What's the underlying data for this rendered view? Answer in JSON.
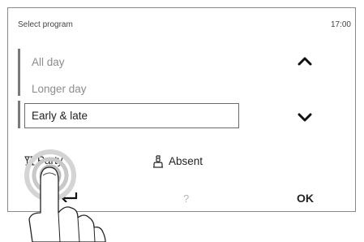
{
  "header": {
    "title": "Select program",
    "time": "17:00"
  },
  "programs": {
    "items": [
      "All day",
      "Longer day"
    ],
    "selected": "Early & late"
  },
  "nav": {
    "up_icon": "chevron-up-icon",
    "down_icon": "chevron-down-icon"
  },
  "actions": {
    "party_label": "Party",
    "absent_label": "Absent",
    "help_label": "?",
    "ok_label": "OK",
    "back_icon": "back-arrow-icon"
  },
  "colors": {
    "text_dark": "#222222",
    "text_muted": "#8c8c8c",
    "border": "#8a8a8a"
  }
}
